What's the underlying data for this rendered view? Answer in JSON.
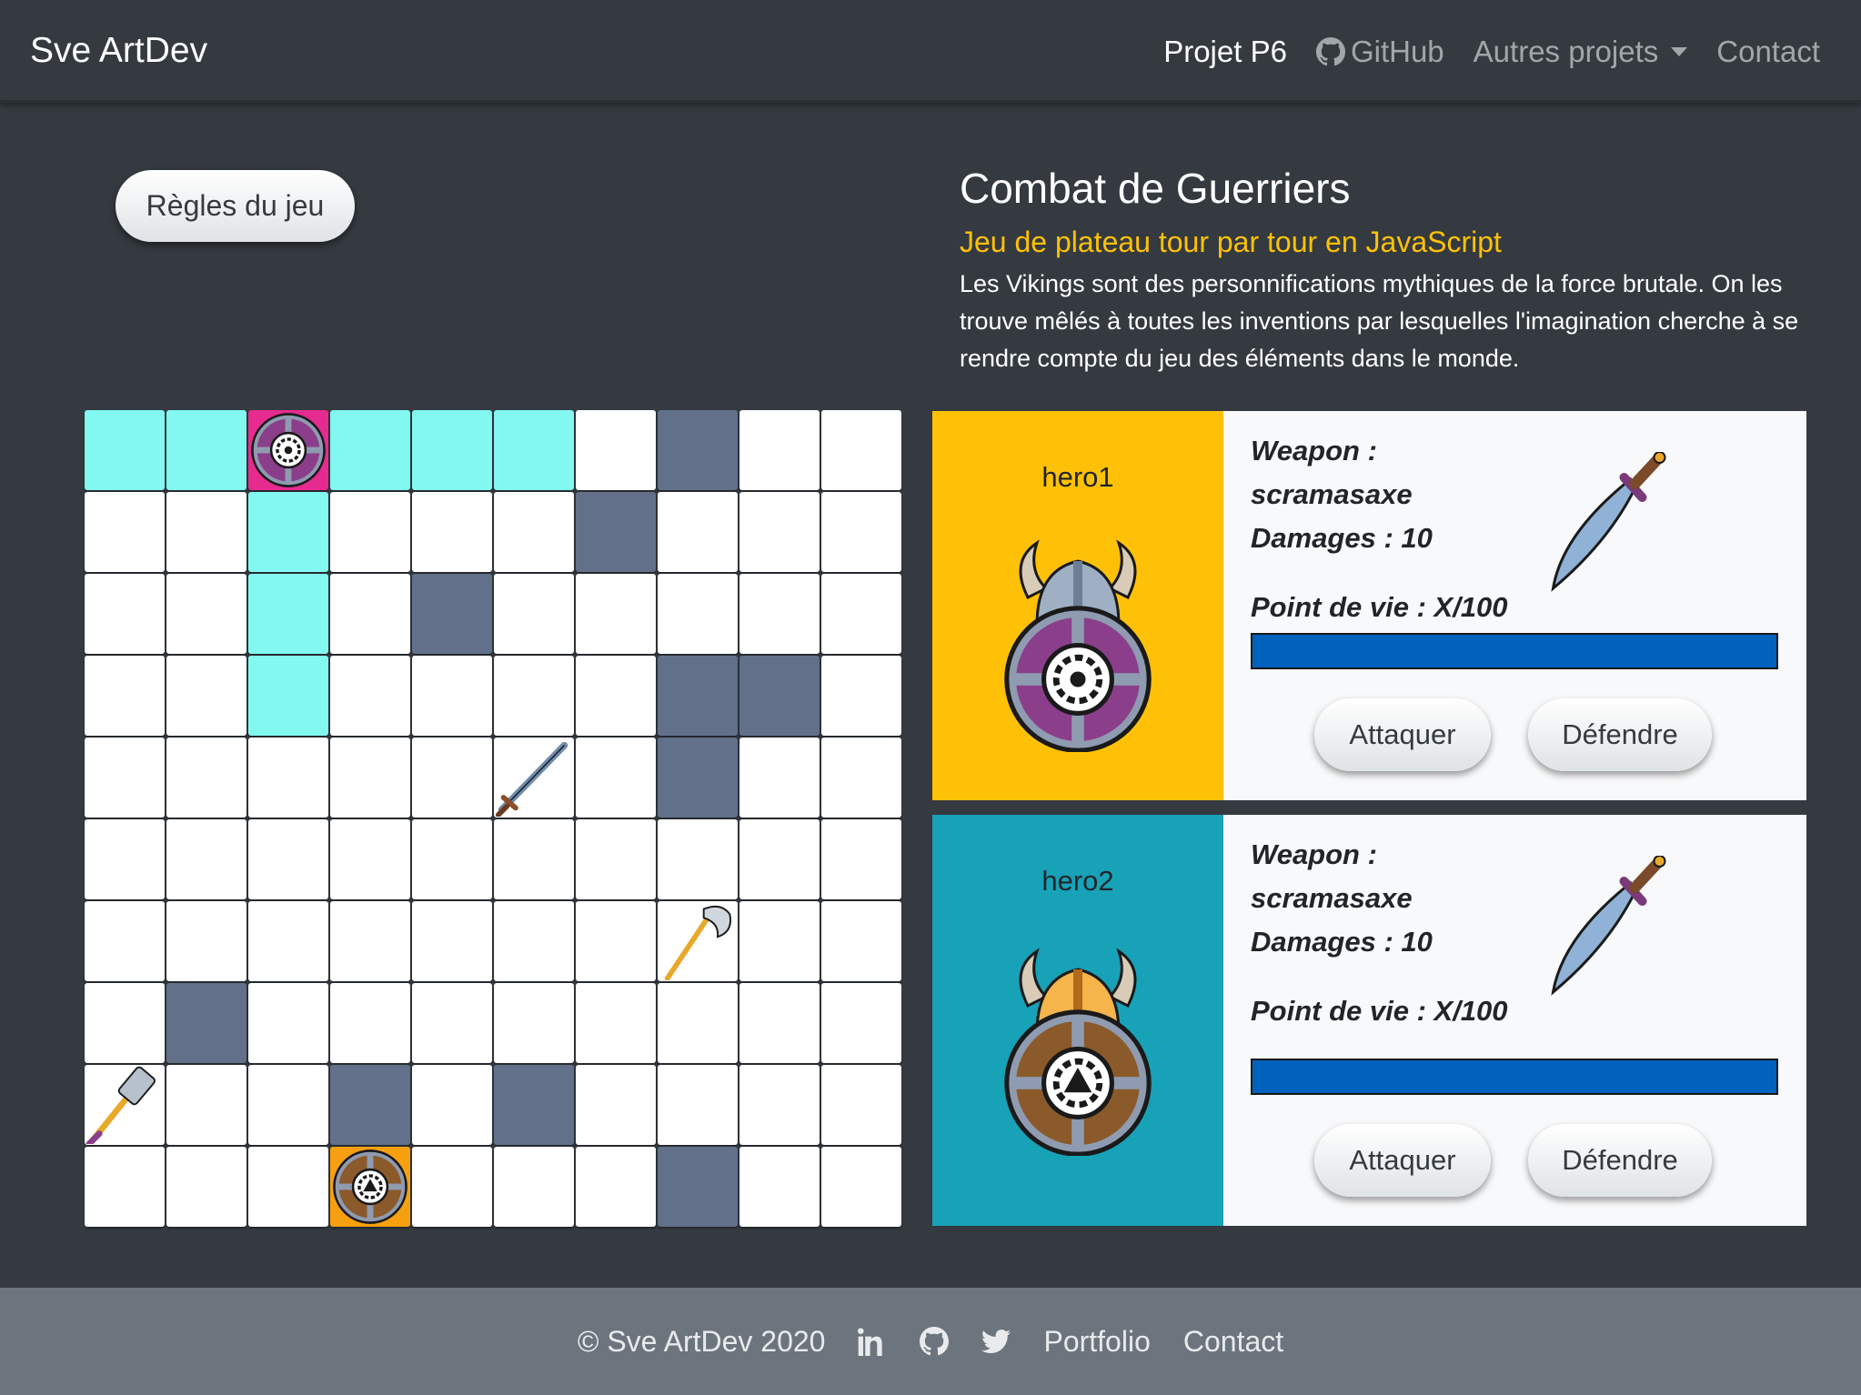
{
  "navbar": {
    "brand": "Sve ArtDev",
    "links": [
      {
        "label": "Projet P6",
        "active": true
      },
      {
        "label": "GitHub",
        "icon": "github-icon"
      },
      {
        "label": "Autres projets",
        "dropdown": true
      },
      {
        "label": "Contact"
      }
    ]
  },
  "rules_button": "Règles du jeu",
  "intro": {
    "title": "Combat de Guerriers",
    "subtitle": "Jeu de plateau tour par tour en JavaScript",
    "description": "Les Vikings sont des personnifications mythiques de la force brutale. On les trouve mêlés à toutes les inventions par lesquelles l'imagination cherche à se rendre compte du jeu des éléments dans le monde."
  },
  "board": {
    "rows": [
      [
        "move",
        "move",
        "player1",
        "move",
        "move",
        "move",
        "empty",
        "wall",
        "empty",
        "empty"
      ],
      [
        "empty",
        "empty",
        "move",
        "empty",
        "empty",
        "empty",
        "wall",
        "empty",
        "empty",
        "empty"
      ],
      [
        "empty",
        "empty",
        "move",
        "empty",
        "wall",
        "empty",
        "empty",
        "empty",
        "empty",
        "empty"
      ],
      [
        "empty",
        "empty",
        "move",
        "empty",
        "empty",
        "empty",
        "empty",
        "wall",
        "wall",
        "empty"
      ],
      [
        "empty",
        "empty",
        "empty",
        "empty",
        "empty",
        "sword",
        "empty",
        "wall",
        "empty",
        "empty"
      ],
      [
        "empty",
        "empty",
        "empty",
        "empty",
        "empty",
        "empty",
        "empty",
        "empty",
        "empty",
        "empty"
      ],
      [
        "empty",
        "empty",
        "empty",
        "empty",
        "empty",
        "empty",
        "empty",
        "axe",
        "empty",
        "empty"
      ],
      [
        "empty",
        "wall",
        "empty",
        "empty",
        "empty",
        "empty",
        "empty",
        "empty",
        "empty",
        "empty"
      ],
      [
        "hammer",
        "empty",
        "empty",
        "wall",
        "empty",
        "wall",
        "empty",
        "empty",
        "empty",
        "empty"
      ],
      [
        "empty",
        "empty",
        "empty",
        "player2",
        "empty",
        "empty",
        "empty",
        "wall",
        "empty",
        "empty"
      ]
    ],
    "colors": {
      "move": "#82f8f1",
      "wall": "#627189",
      "player1": "#e62b8f",
      "player2": "#f7a00f"
    }
  },
  "players": [
    {
      "name": "hero1",
      "weapon_label": "Weapon :",
      "weapon": "scramasaxe",
      "damages": "Damages : 10",
      "hp": "Point de vie : X/100",
      "hp_fraction": 1.0,
      "attack": "Attaquer",
      "defend": "Défendre",
      "color": "#ffc107"
    },
    {
      "name": "hero2",
      "weapon_label": "Weapon :",
      "weapon": "scramasaxe",
      "damages": "Damages : 10",
      "hp": "Point de vie : X/100",
      "hp_fraction": 1.0,
      "attack": "Attaquer",
      "defend": "Défendre",
      "color": "#17a2b8"
    }
  ],
  "footer": {
    "copyright": "© Sve ArtDev 2020",
    "icons": [
      "linkedin-icon",
      "github-icon",
      "twitter-icon"
    ],
    "portfolio": "Portfolio",
    "contact": "Contact"
  }
}
